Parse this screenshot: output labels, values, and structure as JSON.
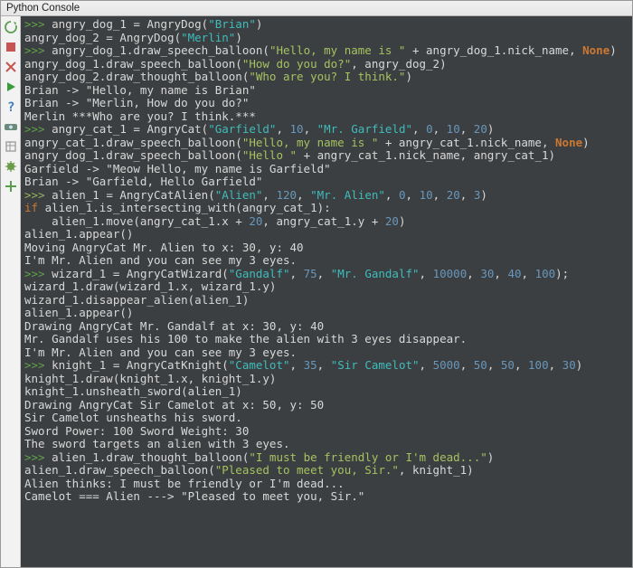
{
  "title": "Python Console",
  "toolbar": {
    "icons": [
      "restart",
      "stop",
      "close",
      "run",
      "help",
      "watch",
      "settings",
      "debug",
      "add"
    ]
  },
  "lines": [
    {
      "t": "in",
      "segs": [
        [
          "prompt",
          ">>> "
        ],
        [
          "plain",
          "angry_dog_1 = AngryDog("
        ],
        [
          "teal",
          "\"Brian\""
        ],
        [
          "plain",
          ")"
        ]
      ]
    },
    {
      "t": "plain",
      "segs": [
        [
          "plain",
          "angry_dog_2 = AngryDog("
        ],
        [
          "teal",
          "\"Merlin\""
        ],
        [
          "plain",
          ")"
        ]
      ]
    },
    {
      "t": "in",
      "segs": [
        [
          "prompt",
          ">>> "
        ],
        [
          "plain",
          "angry_dog_1.draw_speech_balloon("
        ],
        [
          "olive",
          "\"Hello, my name is \""
        ],
        [
          "plain",
          " + angry_dog_1.nick_name, "
        ],
        [
          "orkw",
          "None"
        ],
        [
          "plain",
          ")"
        ]
      ]
    },
    {
      "t": "plain",
      "segs": [
        [
          "plain",
          "angry_dog_1.draw_speech_balloon("
        ],
        [
          "olive",
          "\"How do you do?\""
        ],
        [
          "plain",
          ", angry_dog_2)"
        ]
      ]
    },
    {
      "t": "plain",
      "segs": [
        [
          "plain",
          "angry_dog_2.draw_thought_balloon("
        ],
        [
          "olive",
          "\"Who are you? I think.\""
        ],
        [
          "plain",
          ")"
        ]
      ]
    },
    {
      "t": "out",
      "segs": [
        [
          "plain",
          "Brian -> \"Hello, my name is Brian\""
        ]
      ]
    },
    {
      "t": "out",
      "segs": [
        [
          "plain",
          "Brian -> \"Merlin, How do you do?\""
        ]
      ]
    },
    {
      "t": "out",
      "segs": [
        [
          "plain",
          "Merlin ***Who are you? I think.***"
        ]
      ]
    },
    {
      "t": "in",
      "segs": [
        [
          "prompt",
          ">>> "
        ],
        [
          "plain",
          "angry_cat_1 = AngryCat("
        ],
        [
          "teal",
          "\"Garfield\""
        ],
        [
          "plain",
          ", "
        ],
        [
          "num",
          "10"
        ],
        [
          "plain",
          ", "
        ],
        [
          "teal",
          "\"Mr. Garfield\""
        ],
        [
          "plain",
          ", "
        ],
        [
          "num",
          "0"
        ],
        [
          "plain",
          ", "
        ],
        [
          "num",
          "10"
        ],
        [
          "plain",
          ", "
        ],
        [
          "num",
          "20"
        ],
        [
          "plain",
          ")"
        ]
      ]
    },
    {
      "t": "plain",
      "segs": [
        [
          "plain",
          "angry_cat_1.draw_speech_balloon("
        ],
        [
          "olive",
          "\"Hello, my name is \""
        ],
        [
          "plain",
          " + angry_cat_1.nick_name, "
        ],
        [
          "orkw",
          "None"
        ],
        [
          "plain",
          ")"
        ]
      ]
    },
    {
      "t": "plain",
      "segs": [
        [
          "plain",
          "angry_dog_1.draw_speech_balloon("
        ],
        [
          "olive",
          "\"Hello \""
        ],
        [
          "plain",
          " + angry_cat_1.nick_name, angry_cat_1)"
        ]
      ]
    },
    {
      "t": "out",
      "segs": [
        [
          "plain",
          "Garfield -> \"Meow Hello, my name is Garfield\""
        ]
      ]
    },
    {
      "t": "out",
      "segs": [
        [
          "plain",
          "Brian -> \"Garfield, Hello Garfield\""
        ]
      ]
    },
    {
      "t": "in",
      "segs": [
        [
          "prompt2",
          ">>> "
        ],
        [
          "plain",
          "alien_1 = AngryCatAlien("
        ],
        [
          "teal",
          "\"Alien\""
        ],
        [
          "plain",
          ", "
        ],
        [
          "num",
          "120"
        ],
        [
          "plain",
          ", "
        ],
        [
          "teal",
          "\"Mr. Alien\""
        ],
        [
          "plain",
          ", "
        ],
        [
          "num",
          "0"
        ],
        [
          "plain",
          ", "
        ],
        [
          "num",
          "10"
        ],
        [
          "plain",
          ", "
        ],
        [
          "num",
          "20"
        ],
        [
          "plain",
          ", "
        ],
        [
          "num",
          "3"
        ],
        [
          "plain",
          ")"
        ]
      ]
    },
    {
      "t": "plain",
      "segs": [
        [
          "kw",
          "if "
        ],
        [
          "plain",
          "alien_1.is_intersecting_with(angry_cat_1):"
        ]
      ]
    },
    {
      "t": "plain",
      "segs": [
        [
          "plain",
          "    alien_1.move(angry_cat_1.x + "
        ],
        [
          "num",
          "20"
        ],
        [
          "plain",
          ", angry_cat_1.y + "
        ],
        [
          "num",
          "20"
        ],
        [
          "plain",
          ")"
        ]
      ]
    },
    {
      "t": "plain",
      "segs": [
        [
          "plain",
          "alien_1.appear()"
        ]
      ]
    },
    {
      "t": "out",
      "segs": [
        [
          "plain",
          "Moving AngryCat Mr. Alien to x: 30, y: 40"
        ]
      ]
    },
    {
      "t": "out",
      "segs": [
        [
          "plain",
          "I'm Mr. Alien and you can see my 3 eyes."
        ]
      ]
    },
    {
      "t": "in",
      "segs": [
        [
          "prompt",
          ">>> "
        ],
        [
          "plain",
          "wizard_1 = AngryCatWizard("
        ],
        [
          "teal",
          "\"Gandalf\""
        ],
        [
          "plain",
          ", "
        ],
        [
          "num",
          "75"
        ],
        [
          "plain",
          ", "
        ],
        [
          "teal",
          "\"Mr. Gandalf\""
        ],
        [
          "plain",
          ", "
        ],
        [
          "num",
          "10000"
        ],
        [
          "plain",
          ", "
        ],
        [
          "num",
          "30"
        ],
        [
          "plain",
          ", "
        ],
        [
          "num",
          "40"
        ],
        [
          "plain",
          ", "
        ],
        [
          "num",
          "100"
        ],
        [
          "plain",
          ");"
        ]
      ]
    },
    {
      "t": "plain",
      "segs": [
        [
          "plain",
          "wizard_1.draw(wizard_1.x, wizard_1.y)"
        ]
      ]
    },
    {
      "t": "plain",
      "segs": [
        [
          "plain",
          "wizard_1.disappear_alien(alien_1)"
        ]
      ]
    },
    {
      "t": "plain",
      "segs": [
        [
          "plain",
          "alien_1.appear()"
        ]
      ]
    },
    {
      "t": "out",
      "segs": [
        [
          "plain",
          "Drawing AngryCat Mr. Gandalf at x: 30, y: 40"
        ]
      ]
    },
    {
      "t": "out",
      "segs": [
        [
          "plain",
          "Mr. Gandalf uses his 100 to make the alien with 3 eyes disappear."
        ]
      ]
    },
    {
      "t": "out",
      "segs": [
        [
          "plain",
          "I'm Mr. Alien and you can see my 3 eyes."
        ]
      ]
    },
    {
      "t": "in",
      "segs": [
        [
          "prompt",
          ">>> "
        ],
        [
          "plain",
          "knight_1 = AngryCatKnight("
        ],
        [
          "teal",
          "\"Camelot\""
        ],
        [
          "plain",
          ", "
        ],
        [
          "num",
          "35"
        ],
        [
          "plain",
          ", "
        ],
        [
          "teal",
          "\"Sir Camelot\""
        ],
        [
          "plain",
          ", "
        ],
        [
          "num",
          "5000"
        ],
        [
          "plain",
          ", "
        ],
        [
          "num",
          "50"
        ],
        [
          "plain",
          ", "
        ],
        [
          "num",
          "50"
        ],
        [
          "plain",
          ", "
        ],
        [
          "num",
          "100"
        ],
        [
          "plain",
          ", "
        ],
        [
          "num",
          "30"
        ],
        [
          "plain",
          ")"
        ]
      ]
    },
    {
      "t": "plain",
      "segs": [
        [
          "plain",
          "knight_1.draw(knight_1.x, knight_1.y)"
        ]
      ]
    },
    {
      "t": "plain",
      "segs": [
        [
          "plain",
          "knight_1.unsheath_sword(alien_1)"
        ]
      ]
    },
    {
      "t": "out",
      "segs": [
        [
          "plain",
          "Drawing AngryCat Sir Camelot at x: 50, y: 50"
        ]
      ]
    },
    {
      "t": "out",
      "segs": [
        [
          "plain",
          "Sir Camelot unsheaths his sword."
        ]
      ]
    },
    {
      "t": "out",
      "segs": [
        [
          "plain",
          "Sword Power: 100 Sword Weight: 30"
        ]
      ]
    },
    {
      "t": "out",
      "segs": [
        [
          "plain",
          "The sword targets an alien with 3 eyes."
        ]
      ]
    },
    {
      "t": "in",
      "segs": [
        [
          "prompt",
          ">>> "
        ],
        [
          "plain",
          "alien_1.draw_thought_balloon("
        ],
        [
          "olive",
          "\"I must be friendly or I'm dead...\""
        ],
        [
          "plain",
          ")"
        ]
      ]
    },
    {
      "t": "plain",
      "segs": [
        [
          "plain",
          "alien_1.draw_speech_balloon("
        ],
        [
          "olive",
          "\"Pleased to meet you, Sir.\""
        ],
        [
          "plain",
          ", knight_1)"
        ]
      ]
    },
    {
      "t": "out",
      "segs": [
        [
          "plain",
          "Alien thinks: I must be friendly or I'm dead..."
        ]
      ]
    },
    {
      "t": "out",
      "segs": [
        [
          "plain",
          "Camelot === Alien ---> \"Pleased to meet you, Sir.\""
        ]
      ]
    }
  ]
}
